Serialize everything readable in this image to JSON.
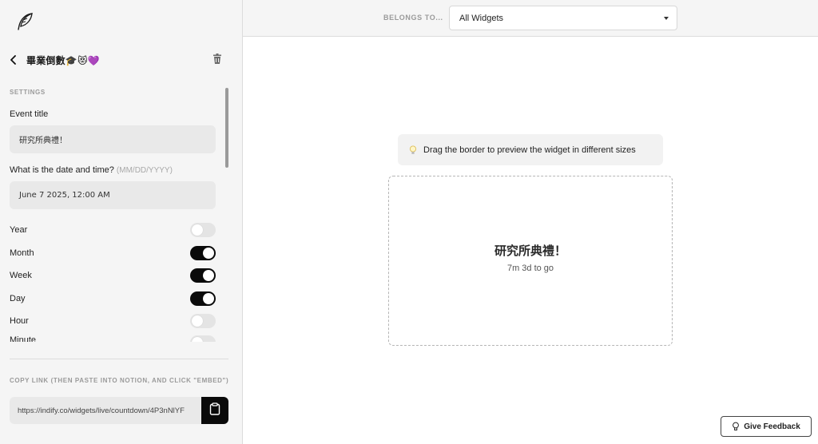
{
  "sidebar": {
    "logo_icon": "feather-icon",
    "widget_name": "畢業倒數🎓😻💜",
    "settings_label": "SETTINGS",
    "event_title_label": "Event title",
    "event_title_value": "研究所典禮！",
    "date_label": "What is the date and time?",
    "date_hint": "(MM/DD/YYYY)",
    "date_value": "June 7 2025, 12:00 AM",
    "toggles": [
      {
        "label": "Year",
        "on": false
      },
      {
        "label": "Month",
        "on": true
      },
      {
        "label": "Week",
        "on": true
      },
      {
        "label": "Day",
        "on": true
      },
      {
        "label": "Hour",
        "on": false
      },
      {
        "label": "Minute",
        "on": false
      }
    ],
    "copy_label": "COPY LINK (THEN PASTE INTO NOTION, AND CLICK \"EMBED\")",
    "link_value": "https://indify.co/widgets/live/countdown/4P3nNlYF"
  },
  "topbar": {
    "belongs_label": "BELONGS TO...",
    "select_value": "All Widgets"
  },
  "main": {
    "tip_text": "Drag the border to preview the widget in different sizes",
    "preview_title": "研究所典禮！",
    "preview_subtitle": "7m 3d to go",
    "feedback_label": "Give Feedback"
  },
  "colors": {
    "sidebar_bg": "#f5f5f5",
    "toggle_on": "#0a0a0a",
    "toggle_off": "#e4e4e4",
    "field_bg": "#e9e9e9"
  }
}
